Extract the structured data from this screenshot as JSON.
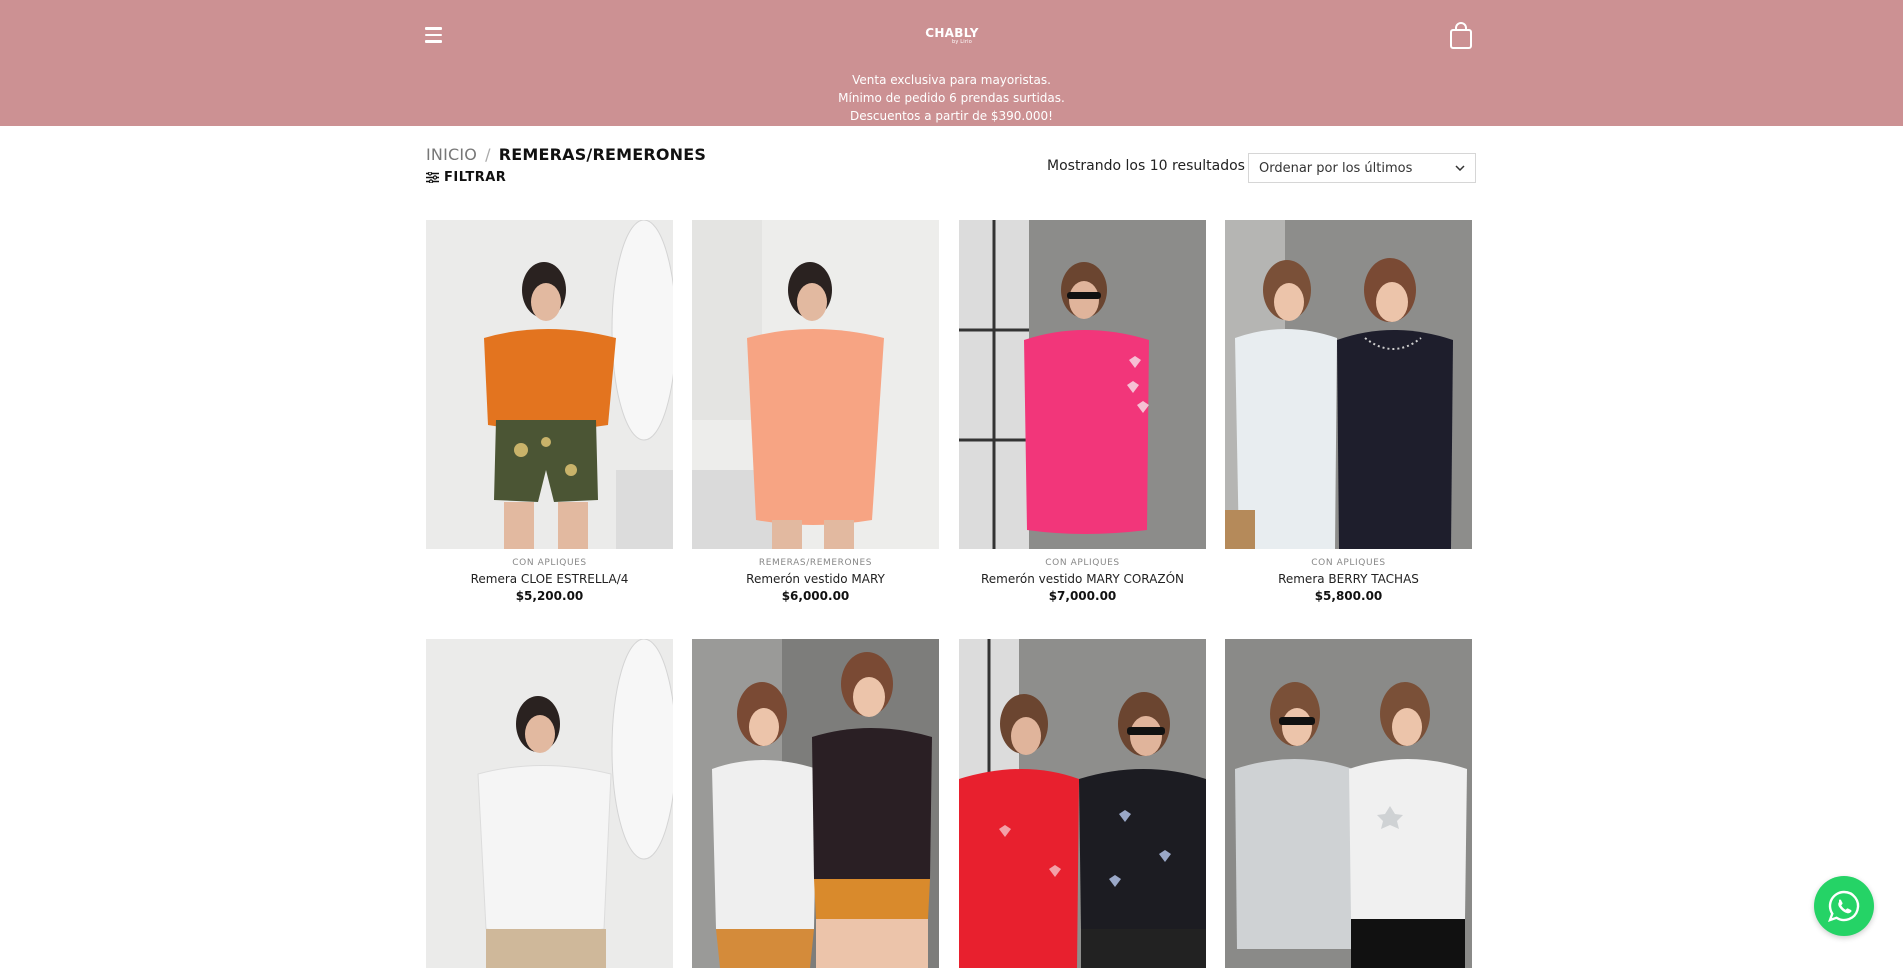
{
  "header": {
    "brand": "CHABLY",
    "brand_tagline": "by Lirio",
    "notice_lines": [
      "Venta exclusiva para mayoristas.",
      "Mínimo de pedido 6 prendas surtidas.",
      "Descuentos a partir de $390.000!"
    ],
    "bg_color": "#cc9193"
  },
  "breadcrumb": {
    "home": "INICIO",
    "separator": "/",
    "current": "REMERAS/REMERONES"
  },
  "filter_label": "FILTRAR",
  "results_text": "Mostrando los 10 resultados",
  "sort": {
    "selected": "Ordenar por los últimos"
  },
  "products": [
    {
      "category": "CON APLIQUES",
      "title": "Remera CLOE ESTRELLA/4",
      "price": "$5,200.00"
    },
    {
      "category": "REMERAS/REMERONES",
      "title": "Remerón vestido MARY",
      "price": "$6,000.00"
    },
    {
      "category": "CON APLIQUES",
      "title": "Remerón vestido MARY CORAZÓN",
      "price": "$7,000.00"
    },
    {
      "category": "CON APLIQUES",
      "title": "Remera BERRY TACHAS",
      "price": "$5,800.00"
    },
    {
      "category": "",
      "title": "",
      "price": ""
    },
    {
      "category": "",
      "title": "",
      "price": ""
    },
    {
      "category": "",
      "title": "",
      "price": ""
    },
    {
      "category": "",
      "title": "",
      "price": ""
    }
  ],
  "icons": [
    "menu-icon",
    "cart-icon",
    "filter-icon",
    "chevron-down-icon",
    "whatsapp-icon"
  ]
}
